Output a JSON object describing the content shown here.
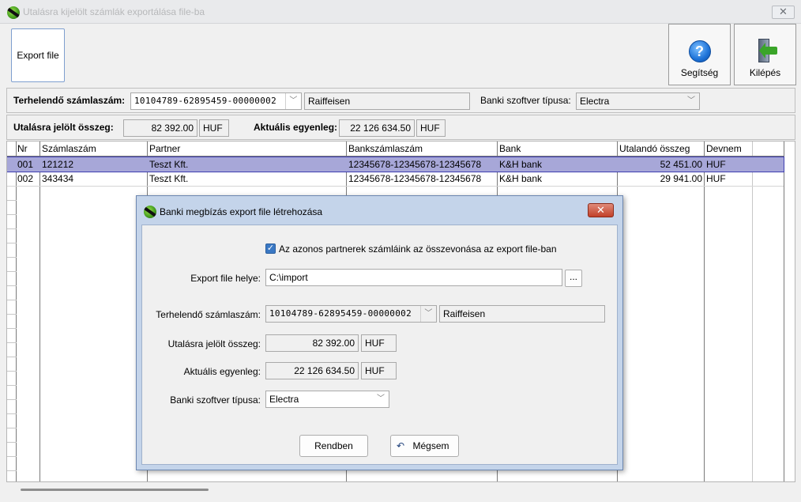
{
  "window": {
    "title": "Utalásra kijelölt számlák exportálása file-ba",
    "close_glyph": "✕"
  },
  "toolbar": {
    "export_label": "Export file",
    "help_label": "Segítség",
    "help_glyph": "?",
    "exit_label": "Kilépés"
  },
  "account_bar": {
    "account_label": "Terhelendő számlaszám:",
    "account_value": "10104789-62895459-00000002",
    "bank_name": "Raiffeisen",
    "software_label": "Banki szoftver típusa:",
    "software_value": "Electra"
  },
  "totals_bar": {
    "marked_label": "Utalásra jelölt összeg:",
    "marked_value": "82 392.00",
    "marked_currency": "HUF",
    "balance_label": "Aktuális egyenleg:",
    "balance_value": "22 126 634.50",
    "balance_currency": "HUF"
  },
  "table": {
    "columns": [
      "Nr",
      "Számlaszám",
      "Partner",
      "Bankszámlaszám",
      "Bank",
      "Utalandó összeg",
      "Devnem"
    ],
    "rows": [
      [
        "001",
        "121212",
        "Teszt Kft.",
        "12345678-12345678-12345678",
        "K&H bank",
        "52 451.00",
        "HUF"
      ],
      [
        "002",
        "343434",
        "Teszt Kft.",
        "12345678-12345678-12345678",
        "K&H bank",
        "29 941.00",
        "HUF"
      ]
    ]
  },
  "dialog": {
    "title": "Banki megbízás export file létrehozása",
    "close_glyph": "✕",
    "merge_checkbox_label": "Az azonos partnerek számláink az összevonása az export file-ban",
    "merge_checked": true,
    "path_label": "Export file helye:",
    "path_value": "C:\\import",
    "browse_label": "...",
    "account_label": "Terhelendő számlaszám:",
    "account_value": "10104789-62895459-00000002",
    "bank_name": "Raiffeisen",
    "marked_label": "Utalásra jelölt összeg:",
    "marked_value": "82 392.00",
    "marked_currency": "HUF",
    "balance_label": "Aktuális egyenleg:",
    "balance_value": "22 126 634.50",
    "balance_currency": "HUF",
    "software_label": "Banki szoftver típusa:",
    "software_value": "Electra",
    "ok_label": "Rendben",
    "cancel_label": "Mégsem",
    "cancel_glyph": "↶"
  },
  "colors": {
    "selected_row": "#a7a7d8",
    "dialog_frame": "#c4d4ea",
    "dialog_close": "#c2402a"
  }
}
